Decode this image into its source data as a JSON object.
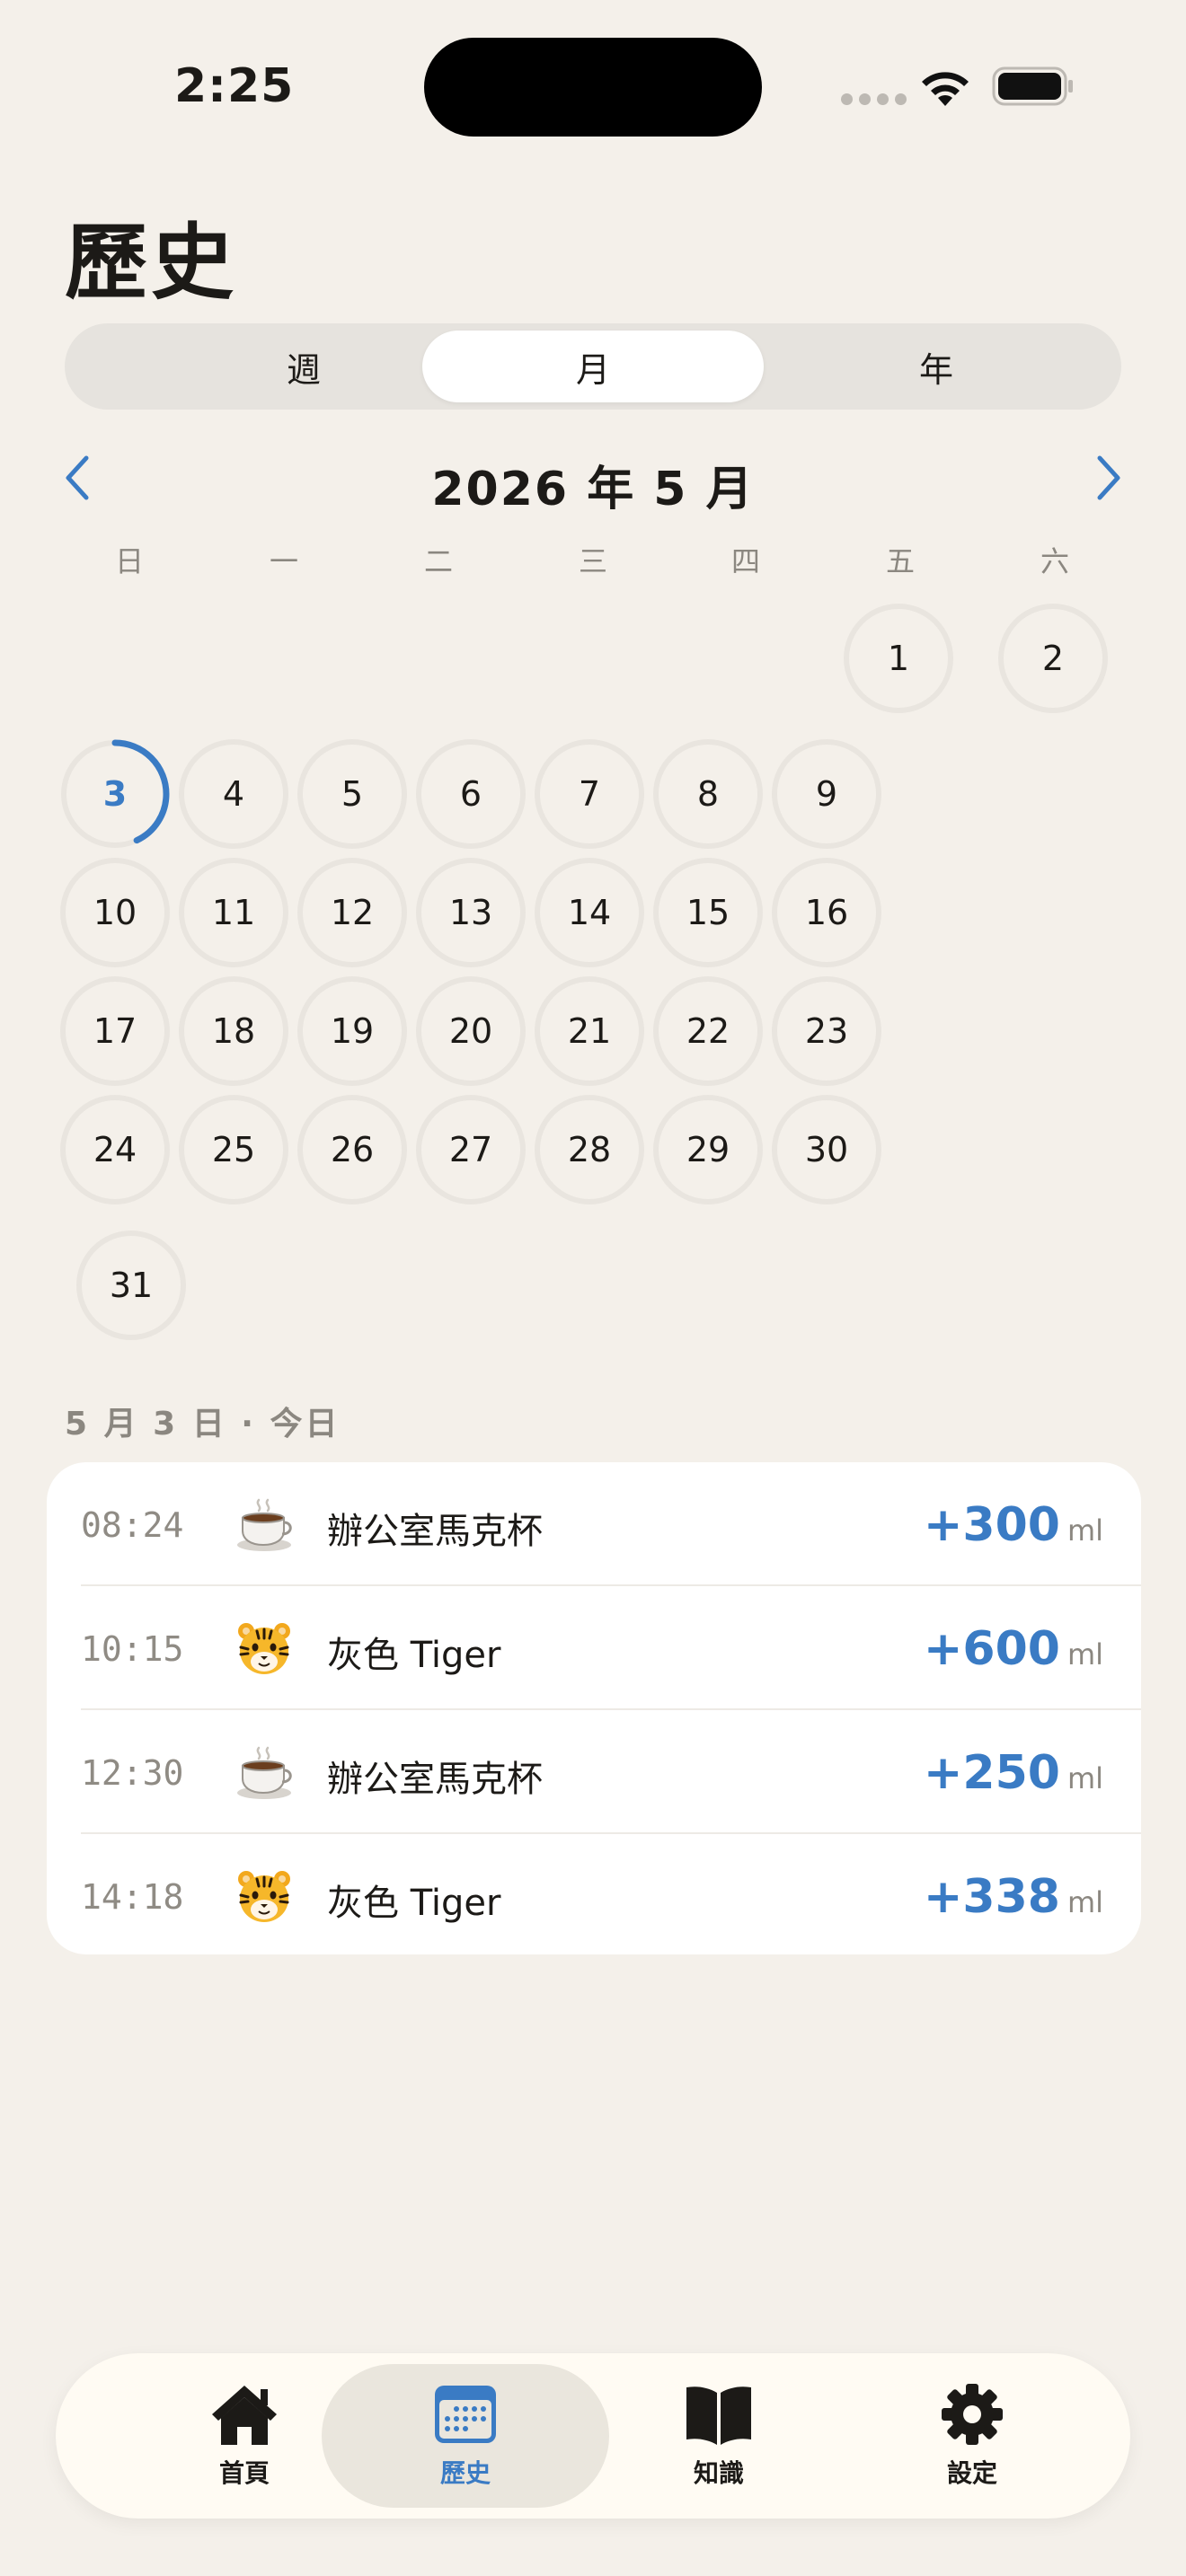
{
  "status_bar": {
    "time": "2:25"
  },
  "page": {
    "title": "歷史"
  },
  "segmented": {
    "week": "週",
    "month": "月",
    "year": "年",
    "selected": "月"
  },
  "calendar": {
    "month_title": "2026 年 5 月",
    "weekdays": [
      "日",
      "一",
      "二",
      "三",
      "四",
      "五",
      "六"
    ],
    "days": [
      "1",
      "2",
      "3",
      "4",
      "5",
      "6",
      "7",
      "8",
      "9",
      "10",
      "11",
      "12",
      "13",
      "14",
      "15",
      "16",
      "17",
      "18",
      "19",
      "20",
      "21",
      "22",
      "23",
      "24",
      "25",
      "26",
      "27",
      "28",
      "29",
      "30",
      "31"
    ],
    "today": "3",
    "today_progress": 0.43
  },
  "log": {
    "section_label": "5 月 3 日 · 今日",
    "unit": "ml",
    "entries": [
      {
        "time": "08:24",
        "icon": "coffee-cup-icon",
        "name": "辦公室馬克杯",
        "amount": "+300"
      },
      {
        "time": "10:15",
        "icon": "tiger-icon",
        "name": "灰色 Tiger",
        "amount": "+600"
      },
      {
        "time": "12:30",
        "icon": "coffee-cup-icon",
        "name": "辦公室馬克杯",
        "amount": "+250"
      },
      {
        "time": "14:18",
        "icon": "tiger-icon",
        "name": "灰色 Tiger",
        "amount": "+338"
      }
    ]
  },
  "tabbar": {
    "home": "首頁",
    "history": "歷史",
    "knowledge": "知識",
    "settings": "設定",
    "selected": "歷史"
  },
  "colors": {
    "accent": "#3A7BC4",
    "background": "#F4F0EA",
    "card": "#FFFFFF",
    "ring": "#E9E5DF"
  }
}
